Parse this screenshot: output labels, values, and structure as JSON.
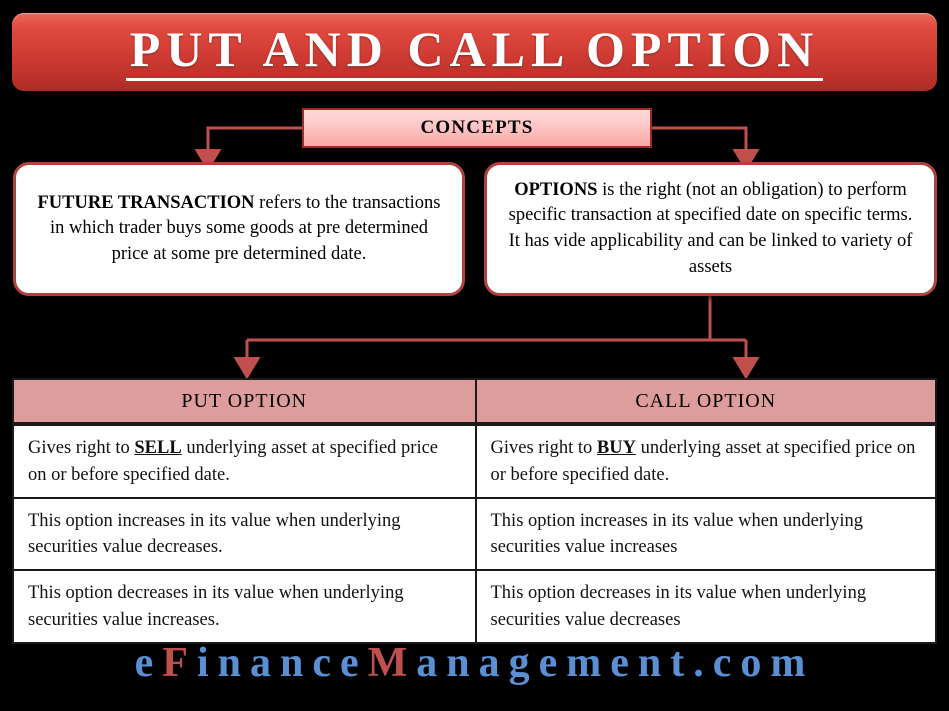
{
  "title": {
    "text": "PUT AND CALL OPTION",
    "banner_color": "#cf3b33",
    "text_color": "#ffffff"
  },
  "concepts": {
    "label": "CONCEPTS",
    "box_color": "#ffc9c8",
    "border_color": "#9c2b26"
  },
  "concept_boxes": [
    {
      "heading": "FUTURE TRANSACTION",
      "body": " refers to the transactions in which trader buys some goods at pre determined price at some pre determined date."
    },
    {
      "heading": "OPTIONS",
      "body": " is the right (not an obligation) to perform specific transaction at specified date on specific terms. It has vide applicability and can be linked to variety of assets"
    }
  ],
  "table": {
    "header_color": "#dd9d9c",
    "headers": [
      "PUT OPTION",
      "CALL OPTION"
    ],
    "rows": [
      {
        "put_prefix": "Gives right to ",
        "put_keyword": "SELL",
        "put_suffix": " underlying asset at specified price on or before specified date.",
        "call_prefix": "Gives right to ",
        "call_keyword": "BUY",
        "call_suffix": " underlying asset at specified price on or before specified date."
      },
      {
        "put_text": "This option increases in its value when underlying securities value decreases.",
        "call_text": "This option increases in its value when underlying securities value increases"
      },
      {
        "put_text": "This option decreases in its value when underlying securities value increases.",
        "call_text": "This option decreases in its value when underlying securities value decreases"
      }
    ]
  },
  "footer": {
    "segments": [
      {
        "text": "e",
        "color": "blue"
      },
      {
        "text": "F",
        "color": "red"
      },
      {
        "text": "inance",
        "color": "blue"
      },
      {
        "text": "M",
        "color": "red"
      },
      {
        "text": "anagement.com",
        "color": "blue"
      }
    ],
    "blue": "#5b8fd4",
    "red": "#c0504d"
  },
  "connector_color": "#c0504d"
}
